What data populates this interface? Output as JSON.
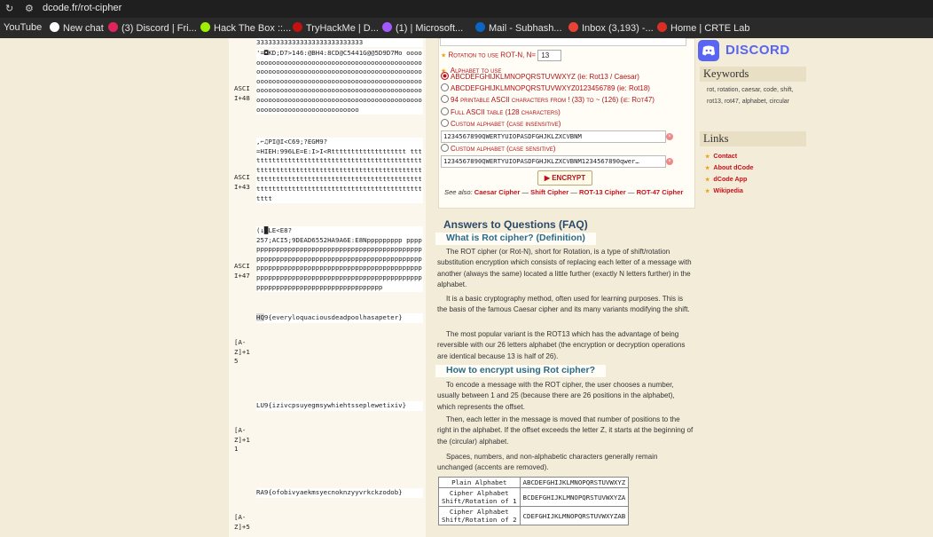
{
  "browser": {
    "url": "dcode.fr/rot-cipher",
    "bookmarks": [
      {
        "label": "YouTube",
        "color": "#ff0000"
      },
      {
        "label": "New chat",
        "color": "#ffffff"
      },
      {
        "label": "(3) Discord | Fri...",
        "color": "#e0245e"
      },
      {
        "label": "Hack The Box ::...",
        "color": "#9fef00"
      },
      {
        "label": "TryHackMe | D...",
        "color": "#c11111"
      },
      {
        "label": "(1) | Microsoft...",
        "color": "#a259ff"
      },
      {
        "label": "Mail - Subhash...",
        "color": "#0a66c2"
      },
      {
        "label": "Inbox (3,193) -...",
        "color": "#ea4335"
      },
      {
        "label": "Home | CRTE Lab",
        "color": "#d93025"
      }
    ]
  },
  "results": [
    {
      "label": "",
      "text": "333333333333333333333333333"
    },
    {
      "label": "ASCI\nI+48",
      "text": "'=◘KD;D7>146:@BH4:8CD@C5441G@@5D9D7Mo oooooooooooooooooooooooooooooooooooooooooooooooooooooooooooooooooooooooooooooooooooooooooooooooooooooooooooooooooooooooooooooooooooooooooooooooooooooooooooooooooooooooooooooooooooooooooooooooooooooooooooooooooooooooooooooooooooooooooooooooo"
    },
    {
      "label": "ASCI\nI+43",
      "text": ",⌐♫PI@I<C69;?EGM9?\n=HIEH:996LE=E:I>I<Rttttttttttttttttttt ttttttttttttttttttttttttttttttttttttttttttttttttttttttttttttttttttttttttttttttttttttttttttttttttttttttttttttttttttttttttttttttttttttttttttttttttttttttttttttttttttttttttttttttt"
    },
    {
      "label": "ASCI\nI+47",
      "text": "(↓█LE<E8?\n257;ACI5;9DEAD6552HA9A6E:E8Nppppppppp pppppppppppppppppppppppppppppppppppppppppppppppppppppppppppppppppppppppppppppppppppppppppppppppppppppppppppppppppppppppppppppppppppppppppppppppppppppppppppppppppppppppppppppppppppppppppppppppppppppppppppp"
    },
    {
      "label": "[A-\nZ]+1\n5",
      "text": "HQ9{everyloquaciousdeadpoolhasapeter}"
    },
    {
      "label": "[A-\nZ]+1\n1",
      "text": "LU9{izivcpsuyegmsywhiehtsseplewetixiv}"
    },
    {
      "label": "[A-\nZ]+5",
      "text": "RA9{ofobivyaekmsyecnoknzyyvrkckzodob}"
    }
  ],
  "form": {
    "rotation_label": "Rotation to use ROT-N, N=",
    "rotation_value": "13",
    "alphabet_label": "Alphabet to use",
    "options": [
      {
        "label": "ABCDEFGHIJKLMNOPQRSTUVWXYZ (ie: Rot13 / Caesar)",
        "checked": true
      },
      {
        "label": "ABCDEFGHIJKLMNOPQRSTUVWXYZ0123456789 (ie: Rot18)",
        "checked": false
      },
      {
        "label": "94 printable ASCII characters from ! (33) to ~ (126) (ie: Rot47)",
        "checked": false
      },
      {
        "label": "Full ASCII table (128 characters)",
        "checked": false
      },
      {
        "label": "Custom alphabet (case insensitive)",
        "checked": false
      },
      {
        "label": "Custom alphabet (case sensitive)",
        "checked": false
      }
    ],
    "custom_ci_value": "1234567890QWERTYUIOPASDFGHJKLZXCVBNM",
    "custom_cs_value": "1234567890QWERTYUIOPASDFGHJKLZXCVBNM1234567890qwer…",
    "encrypt_label": "▶ ENCRYPT",
    "see_also_prefix": "See also:",
    "see_also_links": [
      "Caesar Cipher",
      "Shift Cipher",
      "ROT-13 Cipher",
      "ROT-47 Cipher"
    ]
  },
  "faq": {
    "title": "Answers to Questions (FAQ)",
    "q1": "What is Rot cipher? (Definition)",
    "p1a": "The ROT cipher (or Rot-N), short for Rotation, is a type of shift/rotation substitution encryption which consists of replacing each letter of a message with another (always the same) located a little further (exactly N letters further) in the alphabet.",
    "p1b": "It is a basic cryptography method, often used for learning purposes. This is the basis of the famous Caesar cipher and its many variants modifying the shift.",
    "p1c": "The most popular variant is the ROT13 which has the advantage of being reversible with our 26 letters alphabet (the encryption or decryption operations are identical because 13 is half of 26).",
    "q2": "How to encrypt using Rot cipher?",
    "p2a": "To encode a message with the ROT cipher, the user chooses a number, usually between 1 and 25 (because there are 26 positions in the alphabet), which represents the offset.",
    "p2b": "Then, each letter in the message is moved that number of positions to the right in the alphabet. If the offset exceeds the letter Z, it starts at the beginning of the (circular) alphabet.",
    "p2c": "Spaces, numbers, and non-alphabetic characters generally remain unchanged (accents are removed).",
    "table": [
      [
        "Plain Alphabet",
        "ABCDEFGHIJKLMNOPQRSTUVWXYZ"
      ],
      [
        "Cipher Alphabet\nShift/Rotation of 1",
        "BCDEFGHIJKLMNOPQRSTUVWXYZA"
      ],
      [
        "Cipher Alphabet\nShift/Rotation of 2",
        "CDEFGHIJKLMNOPQRSTUVWXYZAB"
      ]
    ]
  },
  "sidebar": {
    "discord": "DISCORD",
    "keywords_title": "Keywords",
    "keywords": "rot, rotation, caesar, code, shift, rot13, rot47, alphabet, circular",
    "links_title": "Links",
    "links": [
      "Contact",
      "About dCode",
      "dCode App",
      "Wikipedia"
    ]
  }
}
